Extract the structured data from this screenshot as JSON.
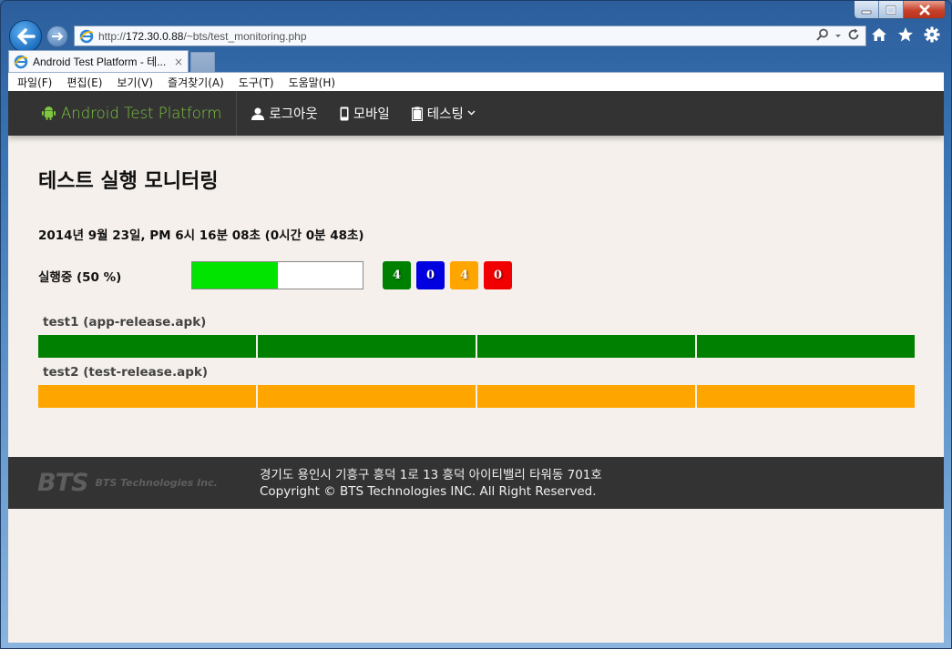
{
  "browser": {
    "url_prefix": "http://",
    "url_host": "172.30.0.88",
    "url_path": "/~bts/test_monitoring.php",
    "tab_title": "Android Test Platform - 테...",
    "tab_close": "×",
    "menu": [
      "파일(F)",
      "편집(E)",
      "보기(V)",
      "즐겨찾기(A)",
      "도구(T)",
      "도움말(H)"
    ],
    "icons": [
      "back-icon",
      "forward-icon",
      "ie-icon",
      "search-icon",
      "refresh-icon",
      "home-icon",
      "favorites-star-icon",
      "settings-gear-icon"
    ]
  },
  "nav": {
    "brand": "Android Test Platform",
    "items": [
      {
        "label": "로그아웃",
        "icon": "user-icon"
      },
      {
        "label": "모바일",
        "icon": "mobile-icon"
      },
      {
        "label": "테스팅",
        "icon": "clipboard-icon",
        "dropdown": true
      }
    ],
    "brand_color": "#7dc63d"
  },
  "page": {
    "title": "테스트 실행 모니터링",
    "timestamp": "2014년 9월 23일, PM 6시 16분 08초 (0시간 0분 48초)",
    "status_label": "실행중 (50 %)",
    "progress_percent": 50,
    "counters": [
      {
        "value": "4",
        "color": "#008000",
        "name": "passed-counter"
      },
      {
        "value": "0",
        "color": "#0000e0",
        "name": "running-counter"
      },
      {
        "value": "4",
        "color": "#ffa500",
        "name": "pending-counter"
      },
      {
        "value": "0",
        "color": "#f00000",
        "name": "failed-counter"
      }
    ],
    "tests": [
      {
        "label": "test1 (app-release.apk)",
        "segments": [
          "#008000",
          "#008000",
          "#008000",
          "#008000"
        ]
      },
      {
        "label": "test2 (test-release.apk)",
        "segments": [
          "#ffa500",
          "#ffa500",
          "#ffa500",
          "#ffa500"
        ]
      }
    ]
  },
  "footer": {
    "logo_text": "BTS",
    "logo_name": "BTS Technologies Inc.",
    "address": "경기도 용인시 기흥구 흥덕 1로 13 흥덕 아이티밸리 타워동 701호",
    "copyright": "Copyright © BTS Technologies INC. All Right Reserved."
  }
}
